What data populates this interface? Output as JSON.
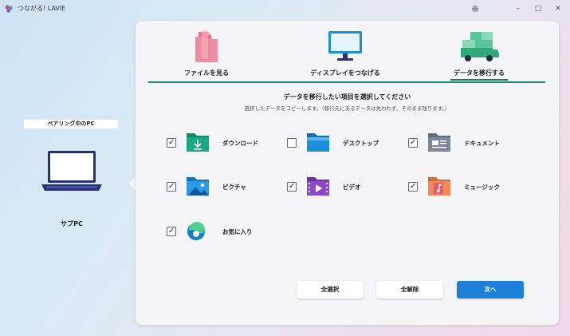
{
  "titlebar": {
    "title": "つながる! LAVIE",
    "settings_icon": "gear-icon",
    "min": "–",
    "max": "□",
    "close": "✕"
  },
  "left": {
    "pairing_label": "ペアリング中のPC",
    "device_name": "サブPC"
  },
  "tabs": [
    {
      "label": "ファイルを見る",
      "icon": "folder-icon"
    },
    {
      "label": "ディスプレイをつなげる",
      "icon": "monitor-icon"
    },
    {
      "label": "データを移行する",
      "icon": "truck-icon",
      "active": true
    }
  ],
  "main": {
    "heading": "データを移行したい項目を選択してください",
    "subheading": "選択したデータをコピーします。（移行元にあるデータは失われず、そのまま残ります。）"
  },
  "items": [
    {
      "label": "ダウンロード",
      "checked": true,
      "icon": "download-folder-icon"
    },
    {
      "label": "デスクトップ",
      "checked": false,
      "icon": "desktop-folder-icon"
    },
    {
      "label": "ドキュメント",
      "checked": true,
      "icon": "documents-folder-icon"
    },
    {
      "label": "ピクチャ",
      "checked": true,
      "icon": "pictures-folder-icon"
    },
    {
      "label": "ビデオ",
      "checked": true,
      "icon": "videos-folder-icon"
    },
    {
      "label": "ミュージック",
      "checked": true,
      "icon": "music-folder-icon"
    },
    {
      "label": "お気に入り",
      "checked": true,
      "icon": "edge-icon"
    }
  ],
  "buttons": {
    "select_all": "全選択",
    "deselect_all": "全解除",
    "next": "次へ"
  },
  "colors": {
    "accent_green": "#1f8a64",
    "primary_blue": "#1e7fd8"
  }
}
